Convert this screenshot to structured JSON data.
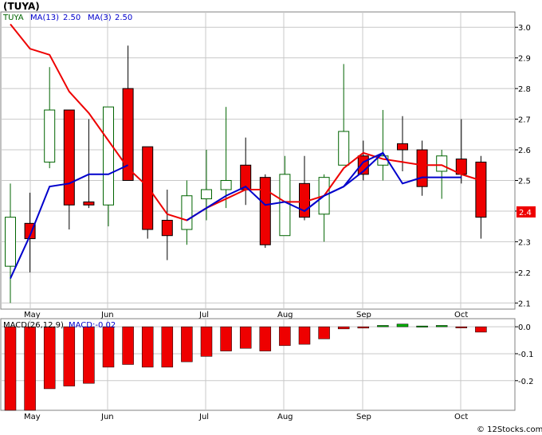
{
  "ticker_title": "(TUYA)",
  "credit": "© 12Stocks.com",
  "price_panel": {
    "legend": [
      {
        "text": "TUYA",
        "color": "#006400"
      },
      {
        "text": "MA(13)",
        "color": "#0000cc"
      },
      {
        "text": "2.50",
        "color": "#0000cc"
      },
      {
        "text": "MA(3)",
        "color": "#0000cc"
      },
      {
        "text": "2.50",
        "color": "#0000cc"
      }
    ],
    "y_ticks": [
      "3.0",
      "2.9",
      "2.8",
      "2.7",
      "2.6",
      "2.5",
      "2.4",
      "2.3",
      "2.2",
      "2.1"
    ],
    "last_price_badge": "2.4",
    "x_labels": [
      "May",
      "Jun",
      "Jul",
      "Aug",
      "Sep",
      "Oct"
    ]
  },
  "macd_panel": {
    "legend": [
      {
        "text": "MACD(26,12,9)",
        "color": "#000000"
      },
      {
        "text": "MACD:-0.02",
        "color": "#0000cc"
      }
    ],
    "y_ticks": [
      "0.0",
      "-0.1",
      "-0.2"
    ],
    "x_labels": [
      "May",
      "Jun",
      "Jul",
      "Aug",
      "Sep",
      "Oct"
    ]
  },
  "colors": {
    "up_candle_fill": "#ffffff",
    "up_candle_border": "#006400",
    "down_candle_fill": "#ee0000",
    "down_candle_border": "#000000",
    "ma13_line": "#ee0000",
    "ma3_line": "#0000cc",
    "macd_bar": "#ee0000",
    "macd_bar_positive": "#00aa00",
    "grid": "#c8c8c8",
    "badge": "#ee0000"
  },
  "chart_data": [
    {
      "type": "candlestick",
      "title": "(TUYA)",
      "ylim": [
        2.08,
        3.05
      ],
      "x_months": [
        "May",
        "Jun",
        "Jul",
        "Aug",
        "Sep",
        "Oct"
      ],
      "candles": [
        {
          "open": 2.22,
          "close": 2.38,
          "high": 2.49,
          "low": 2.1
        },
        {
          "open": 2.36,
          "close": 2.31,
          "high": 2.46,
          "low": 2.2
        },
        {
          "open": 2.56,
          "close": 2.73,
          "high": 2.87,
          "low": 2.54
        },
        {
          "open": 2.73,
          "close": 2.42,
          "high": 2.73,
          "low": 2.34
        },
        {
          "open": 2.43,
          "close": 2.42,
          "high": 2.7,
          "low": 2.41
        },
        {
          "open": 2.42,
          "close": 2.74,
          "high": 2.74,
          "low": 2.35
        },
        {
          "open": 2.8,
          "close": 2.5,
          "high": 2.94,
          "low": 2.5
        },
        {
          "open": 2.61,
          "close": 2.34,
          "high": 2.61,
          "low": 2.31
        },
        {
          "open": 2.37,
          "close": 2.32,
          "high": 2.47,
          "low": 2.24
        },
        {
          "open": 2.34,
          "close": 2.45,
          "high": 2.5,
          "low": 2.29
        },
        {
          "open": 2.44,
          "close": 2.47,
          "high": 2.6,
          "low": 2.37
        },
        {
          "open": 2.47,
          "close": 2.5,
          "high": 2.74,
          "low": 2.41
        },
        {
          "open": 2.55,
          "close": 2.47,
          "high": 2.64,
          "low": 2.42
        },
        {
          "open": 2.51,
          "close": 2.29,
          "high": 2.52,
          "low": 2.28
        },
        {
          "open": 2.32,
          "close": 2.52,
          "high": 2.58,
          "low": 2.32
        },
        {
          "open": 2.49,
          "close": 2.38,
          "high": 2.58,
          "low": 2.37
        },
        {
          "open": 2.39,
          "close": 2.51,
          "high": 2.52,
          "low": 2.3
        },
        {
          "open": 2.55,
          "close": 2.66,
          "high": 2.88,
          "low": 2.55
        },
        {
          "open": 2.58,
          "close": 2.52,
          "high": 2.63,
          "low": 2.5
        },
        {
          "open": 2.55,
          "close": 2.58,
          "high": 2.73,
          "low": 2.5
        },
        {
          "open": 2.62,
          "close": 2.6,
          "high": 2.71,
          "low": 2.53
        },
        {
          "open": 2.6,
          "close": 2.48,
          "high": 2.63,
          "low": 2.45
        },
        {
          "open": 2.53,
          "close": 2.58,
          "high": 2.6,
          "low": 2.44
        },
        {
          "open": 2.57,
          "close": 2.52,
          "high": 2.7,
          "low": 2.49
        },
        {
          "open": 2.56,
          "close": 2.38,
          "high": 2.58,
          "low": 2.31
        }
      ],
      "series": [
        {
          "name": "MA(13)",
          "values": [
            null,
            null,
            null,
            null,
            null,
            null,
            null,
            null,
            null,
            null,
            null,
            null,
            null,
            2.46,
            2.42,
            2.43,
            2.45,
            2.47,
            2.48,
            2.49,
            2.5,
            2.51,
            2.51,
            2.5,
            null
          ]
        },
        {
          "name": "MA(3)",
          "values": [
            2.18,
            2.32,
            2.48,
            2.49,
            2.52,
            2.52,
            2.55,
            null,
            null,
            2.37,
            2.41,
            2.45,
            2.48,
            2.46,
            2.47,
            2.45,
            2.43,
            2.46,
            2.46,
            2.47,
            null,
            null,
            null,
            null,
            null
          ]
        }
      ],
      "ma13_full": [
        3.01,
        2.93,
        2.91,
        2.79,
        2.72,
        2.63,
        2.54,
        2.48,
        2.39,
        2.37,
        2.41,
        2.44,
        2.47,
        2.47,
        2.43,
        2.43,
        2.45,
        2.54,
        2.59,
        2.57,
        2.56,
        2.55,
        2.55,
        2.52,
        2.5
      ],
      "ma3_full": [
        2.18,
        2.32,
        2.48,
        2.49,
        2.52,
        2.52,
        2.55,
        null,
        null,
        2.37,
        2.41,
        2.45,
        2.48,
        2.42,
        2.43,
        2.4,
        2.45,
        2.48,
        2.53,
        2.59,
        null,
        null,
        null,
        null,
        null
      ],
      "ma3_tail": [
        null,
        null,
        null,
        null,
        null,
        null,
        null,
        null,
        null,
        null,
        null,
        null,
        null,
        null,
        null,
        2.4,
        2.45,
        2.48,
        2.56,
        2.59,
        2.49,
        2.51,
        2.51,
        2.51,
        null
      ],
      "legend_position": "top-left"
    },
    {
      "type": "bar",
      "title": "MACD(26,12,9)",
      "ylim": [
        -0.31,
        0.03
      ],
      "x_months": [
        "May",
        "Jun",
        "Jul",
        "Aug",
        "Sep",
        "Oct"
      ],
      "values": [
        -0.32,
        -0.31,
        -0.23,
        -0.22,
        -0.21,
        -0.15,
        -0.14,
        -0.15,
        -0.15,
        -0.13,
        -0.11,
        -0.09,
        -0.08,
        -0.09,
        -0.07,
        -0.065,
        -0.045,
        -0.008,
        -0.005,
        0.005,
        0.01,
        0.003,
        0.005,
        -0.002,
        -0.02
      ]
    }
  ]
}
